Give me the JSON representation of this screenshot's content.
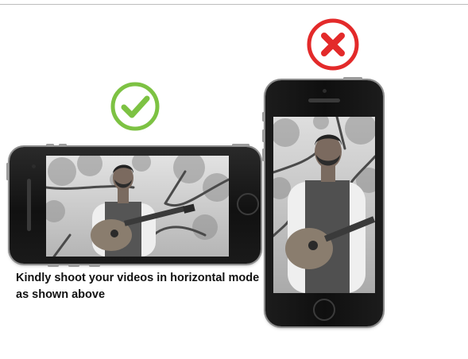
{
  "instruction": {
    "caption": "Kindly shoot your videos in horizontal mode as shown above"
  },
  "indicators": {
    "correct": {
      "icon": "check-mark-icon",
      "color": "#7dc243"
    },
    "incorrect": {
      "icon": "cross-mark-icon",
      "color": "#e32a2a"
    }
  },
  "phones": [
    {
      "orientation": "landscape",
      "status": "correct"
    },
    {
      "orientation": "portrait",
      "status": "incorrect"
    }
  ],
  "video_subject": "man playing acoustic guitar under tree branches"
}
